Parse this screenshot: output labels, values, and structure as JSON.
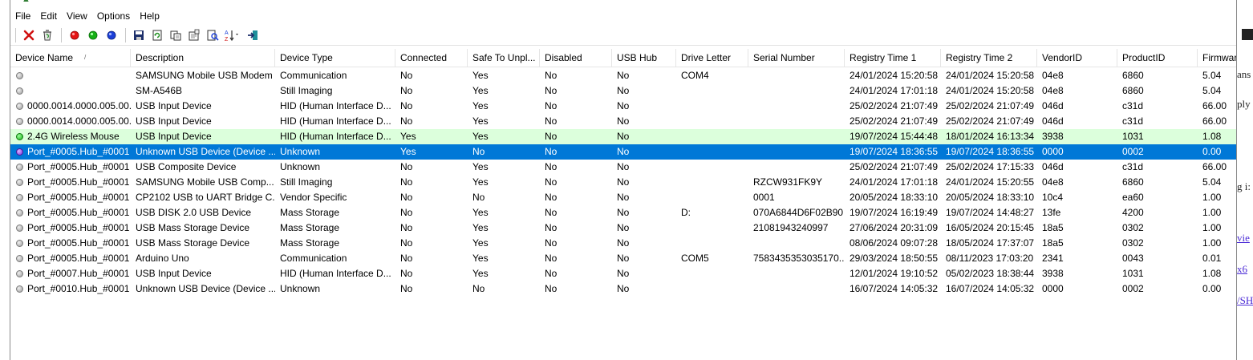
{
  "menu": [
    "File",
    "Edit",
    "View",
    "Options",
    "Help"
  ],
  "toolbar": {
    "buttons": [
      "uninstall-icon",
      "recycle-icon",
      "red-dot-icon",
      "green-dot-icon",
      "blue-dot-icon",
      "save-icon",
      "refresh-icon",
      "copy-icon",
      "properties-icon",
      "find-icon",
      "sort-icon",
      "exit-icon"
    ]
  },
  "columns": [
    "Device Name",
    "Description",
    "Device Type",
    "Connected",
    "Safe To Unpl...",
    "Disabled",
    "USB Hub",
    "Drive Letter",
    "Serial Number",
    "Registry Time 1",
    "Registry Time 2",
    "VendorID",
    "ProductID",
    "Firmware"
  ],
  "sort_indicator": "/",
  "colors": {
    "selection": "#0078d7",
    "highlight_row": "#dcffdc"
  },
  "rows": [
    {
      "status": "gray",
      "cells": [
        "",
        "SAMSUNG Mobile USB Modem",
        "Communication",
        "No",
        "Yes",
        "No",
        "No",
        "COM4",
        "",
        "24/01/2024 15:20:58",
        "24/01/2024 15:20:58",
        "04e8",
        "6860",
        "5.04"
      ]
    },
    {
      "status": "gray",
      "cells": [
        "",
        "SM-A546B",
        "Still Imaging",
        "No",
        "Yes",
        "No",
        "No",
        "",
        "",
        "24/01/2024 17:01:18",
        "24/01/2024 15:20:58",
        "04e8",
        "6860",
        "5.04"
      ]
    },
    {
      "status": "gray",
      "cells": [
        "0000.0014.0000.005.00...",
        "USB Input Device",
        "HID (Human Interface D...",
        "No",
        "Yes",
        "No",
        "No",
        "",
        "",
        "25/02/2024 21:07:49",
        "25/02/2024 21:07:49",
        "046d",
        "c31d",
        "66.00"
      ]
    },
    {
      "status": "gray",
      "cells": [
        "0000.0014.0000.005.00...",
        "USB Input Device",
        "HID (Human Interface D...",
        "No",
        "Yes",
        "No",
        "No",
        "",
        "",
        "25/02/2024 21:07:49",
        "25/02/2024 21:07:49",
        "046d",
        "c31d",
        "66.00"
      ]
    },
    {
      "status": "green",
      "row_style": "hl",
      "cells": [
        "2.4G Wireless Mouse",
        "USB Input Device",
        "HID (Human Interface D...",
        "Yes",
        "Yes",
        "No",
        "No",
        "",
        "",
        "19/07/2024 15:44:48",
        "18/01/2024 16:13:34",
        "3938",
        "1031",
        "1.08"
      ]
    },
    {
      "status": "purple",
      "row_style": "sel",
      "cells": [
        "Port_#0005.Hub_#0001",
        "Unknown USB Device (Device ...",
        "Unknown",
        "Yes",
        "No",
        "No",
        "No",
        "",
        "",
        "19/07/2024 18:36:55",
        "19/07/2024 18:36:55",
        "0000",
        "0002",
        "0.00"
      ]
    },
    {
      "status": "gray",
      "cells": [
        "Port_#0005.Hub_#0001",
        "USB Composite Device",
        "Unknown",
        "No",
        "Yes",
        "No",
        "No",
        "",
        "",
        "25/02/2024 21:07:49",
        "25/02/2024 17:15:33",
        "046d",
        "c31d",
        "66.00"
      ]
    },
    {
      "status": "gray",
      "cells": [
        "Port_#0005.Hub_#0001",
        "SAMSUNG Mobile USB Comp...",
        "Still Imaging",
        "No",
        "Yes",
        "No",
        "No",
        "",
        "RZCW931FK9Y",
        "24/01/2024 17:01:18",
        "24/01/2024 15:20:55",
        "04e8",
        "6860",
        "5.04"
      ]
    },
    {
      "status": "gray",
      "cells": [
        "Port_#0005.Hub_#0001",
        "CP2102 USB to UART Bridge C...",
        "Vendor Specific",
        "No",
        "No",
        "No",
        "No",
        "",
        "0001",
        "20/05/2024 18:33:10",
        "20/05/2024 18:33:10",
        "10c4",
        "ea60",
        "1.00"
      ]
    },
    {
      "status": "gray",
      "cells": [
        "Port_#0005.Hub_#0001",
        "USB DISK 2.0 USB Device",
        "Mass Storage",
        "No",
        "Yes",
        "No",
        "No",
        "D:",
        "070A6844D6F02B90",
        "19/07/2024 16:19:49",
        "19/07/2024 14:48:27",
        "13fe",
        "4200",
        "1.00"
      ]
    },
    {
      "status": "gray",
      "cells": [
        "Port_#0005.Hub_#0001",
        "USB Mass Storage Device",
        "Mass Storage",
        "No",
        "Yes",
        "No",
        "No",
        "",
        "21081943240997",
        "27/06/2024 20:31:09",
        "16/05/2024 20:15:45",
        "18a5",
        "0302",
        "1.00"
      ]
    },
    {
      "status": "gray",
      "cells": [
        "Port_#0005.Hub_#0001",
        "USB Mass Storage Device",
        "Mass Storage",
        "No",
        "Yes",
        "No",
        "No",
        "",
        "",
        "08/06/2024 09:07:28",
        "18/05/2024 17:37:07",
        "18a5",
        "0302",
        "1.00"
      ]
    },
    {
      "status": "gray",
      "cells": [
        "Port_#0005.Hub_#0001",
        "Arduino Uno",
        "Communication",
        "No",
        "Yes",
        "No",
        "No",
        "COM5",
        "7583435353035170...",
        "29/03/2024 18:50:55",
        "08/11/2023 17:03:20",
        "2341",
        "0043",
        "0.01"
      ]
    },
    {
      "status": "gray",
      "cells": [
        "Port_#0007.Hub_#0001",
        "USB Input Device",
        "HID (Human Interface D...",
        "No",
        "Yes",
        "No",
        "No",
        "",
        "",
        "12/01/2024 19:10:52",
        "05/02/2023 18:38:44",
        "3938",
        "1031",
        "1.08"
      ]
    },
    {
      "status": "gray",
      "cells": [
        "Port_#0010.Hub_#0001",
        "Unknown USB Device (Device ...",
        "Unknown",
        "No",
        "No",
        "No",
        "No",
        "",
        "",
        "16/07/2024 14:05:32",
        "16/07/2024 14:05:32",
        "0000",
        "0002",
        "0.00"
      ]
    }
  ],
  "background_window": {
    "fragments": [
      "ans",
      "ply",
      "g i:",
      "vie",
      "x6",
      "/SH"
    ]
  }
}
